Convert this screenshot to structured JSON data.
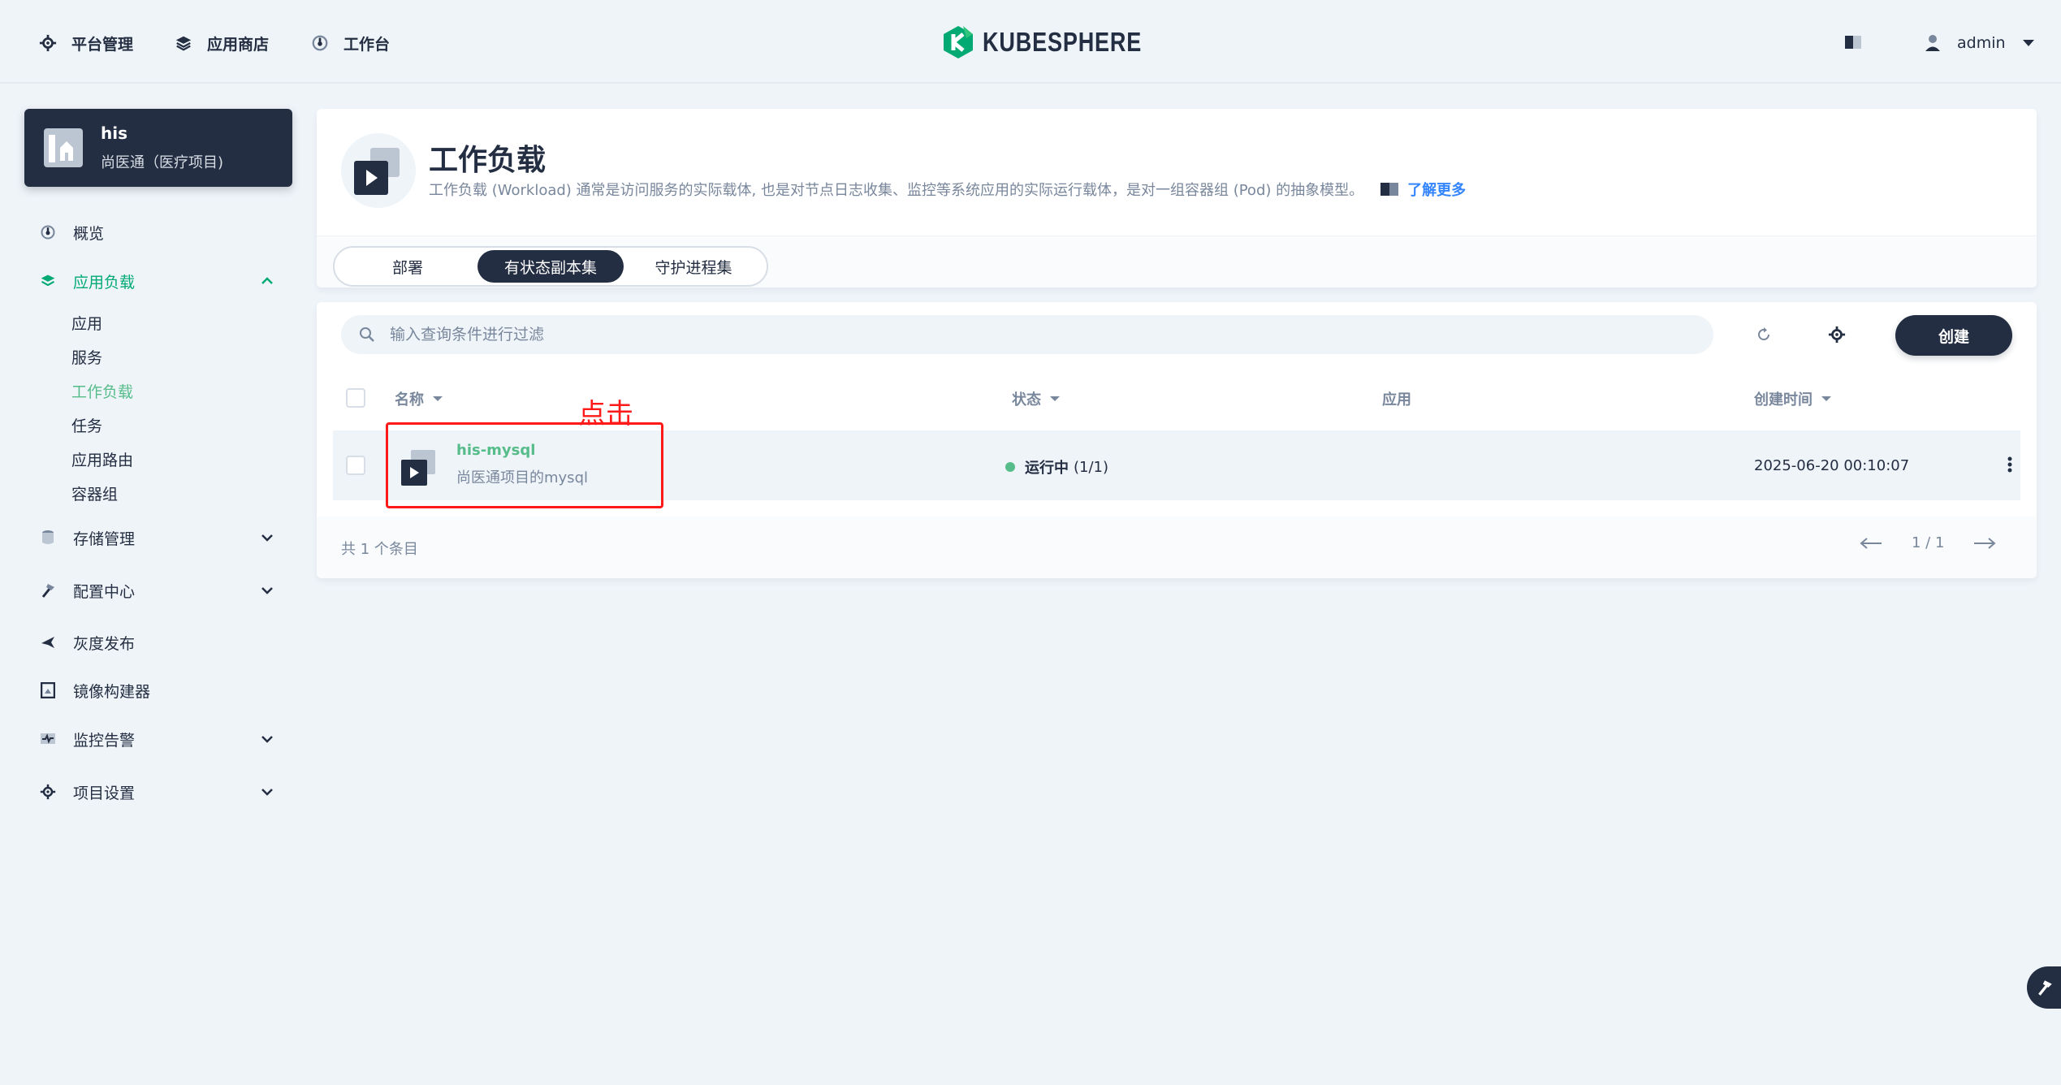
{
  "topnav": {
    "items": [
      {
        "label": "平台管理",
        "icon": "gear-icon"
      },
      {
        "label": "应用商店",
        "icon": "layers-icon"
      },
      {
        "label": "工作台",
        "icon": "dashboard-icon"
      }
    ],
    "logo_text": "KUBESPHERE",
    "user": "admin"
  },
  "project": {
    "name": "his",
    "desc": "尚医通（医疗项目)"
  },
  "sidebar": {
    "items": [
      {
        "label": "概览"
      },
      {
        "label": "应用负载"
      },
      {
        "label": "存储管理"
      },
      {
        "label": "配置中心"
      },
      {
        "label": "灰度发布"
      },
      {
        "label": "镜像构建器"
      },
      {
        "label": "监控告警"
      },
      {
        "label": "项目设置"
      }
    ],
    "subitems": [
      {
        "label": "应用"
      },
      {
        "label": "服务"
      },
      {
        "label": "工作负载"
      },
      {
        "label": "任务"
      },
      {
        "label": "应用路由"
      },
      {
        "label": "容器组"
      }
    ]
  },
  "header": {
    "title": "工作负载",
    "desc": "工作负载 (Workload) 通常是访问服务的实际载体, 也是对节点日志收集、监控等系统应用的实际运行载体，是对一组容器组 (Pod) 的抽象模型。",
    "learn_more": "了解更多"
  },
  "tabs": [
    {
      "label": "部署"
    },
    {
      "label": "有状态副本集"
    },
    {
      "label": "守护进程集"
    }
  ],
  "toolbar": {
    "search_placeholder": "输入查询条件进行过滤",
    "create_label": "创建"
  },
  "table": {
    "columns": [
      "名称",
      "状态",
      "应用",
      "创建时间"
    ],
    "rows": [
      {
        "name": "his-mysql",
        "desc": "尚医通项目的mysql",
        "status": "运行中",
        "replicas": "(1/1)",
        "app": "",
        "created": "2025-06-20 00:10:07"
      }
    ],
    "total": "共 1 个条目",
    "page": "1 / 1"
  },
  "annotation": {
    "label": "点击"
  },
  "colors": {
    "accent": "#55bc8a",
    "dark": "#242e42",
    "annotation": "#ff1a1a",
    "link": "#3385ff"
  }
}
